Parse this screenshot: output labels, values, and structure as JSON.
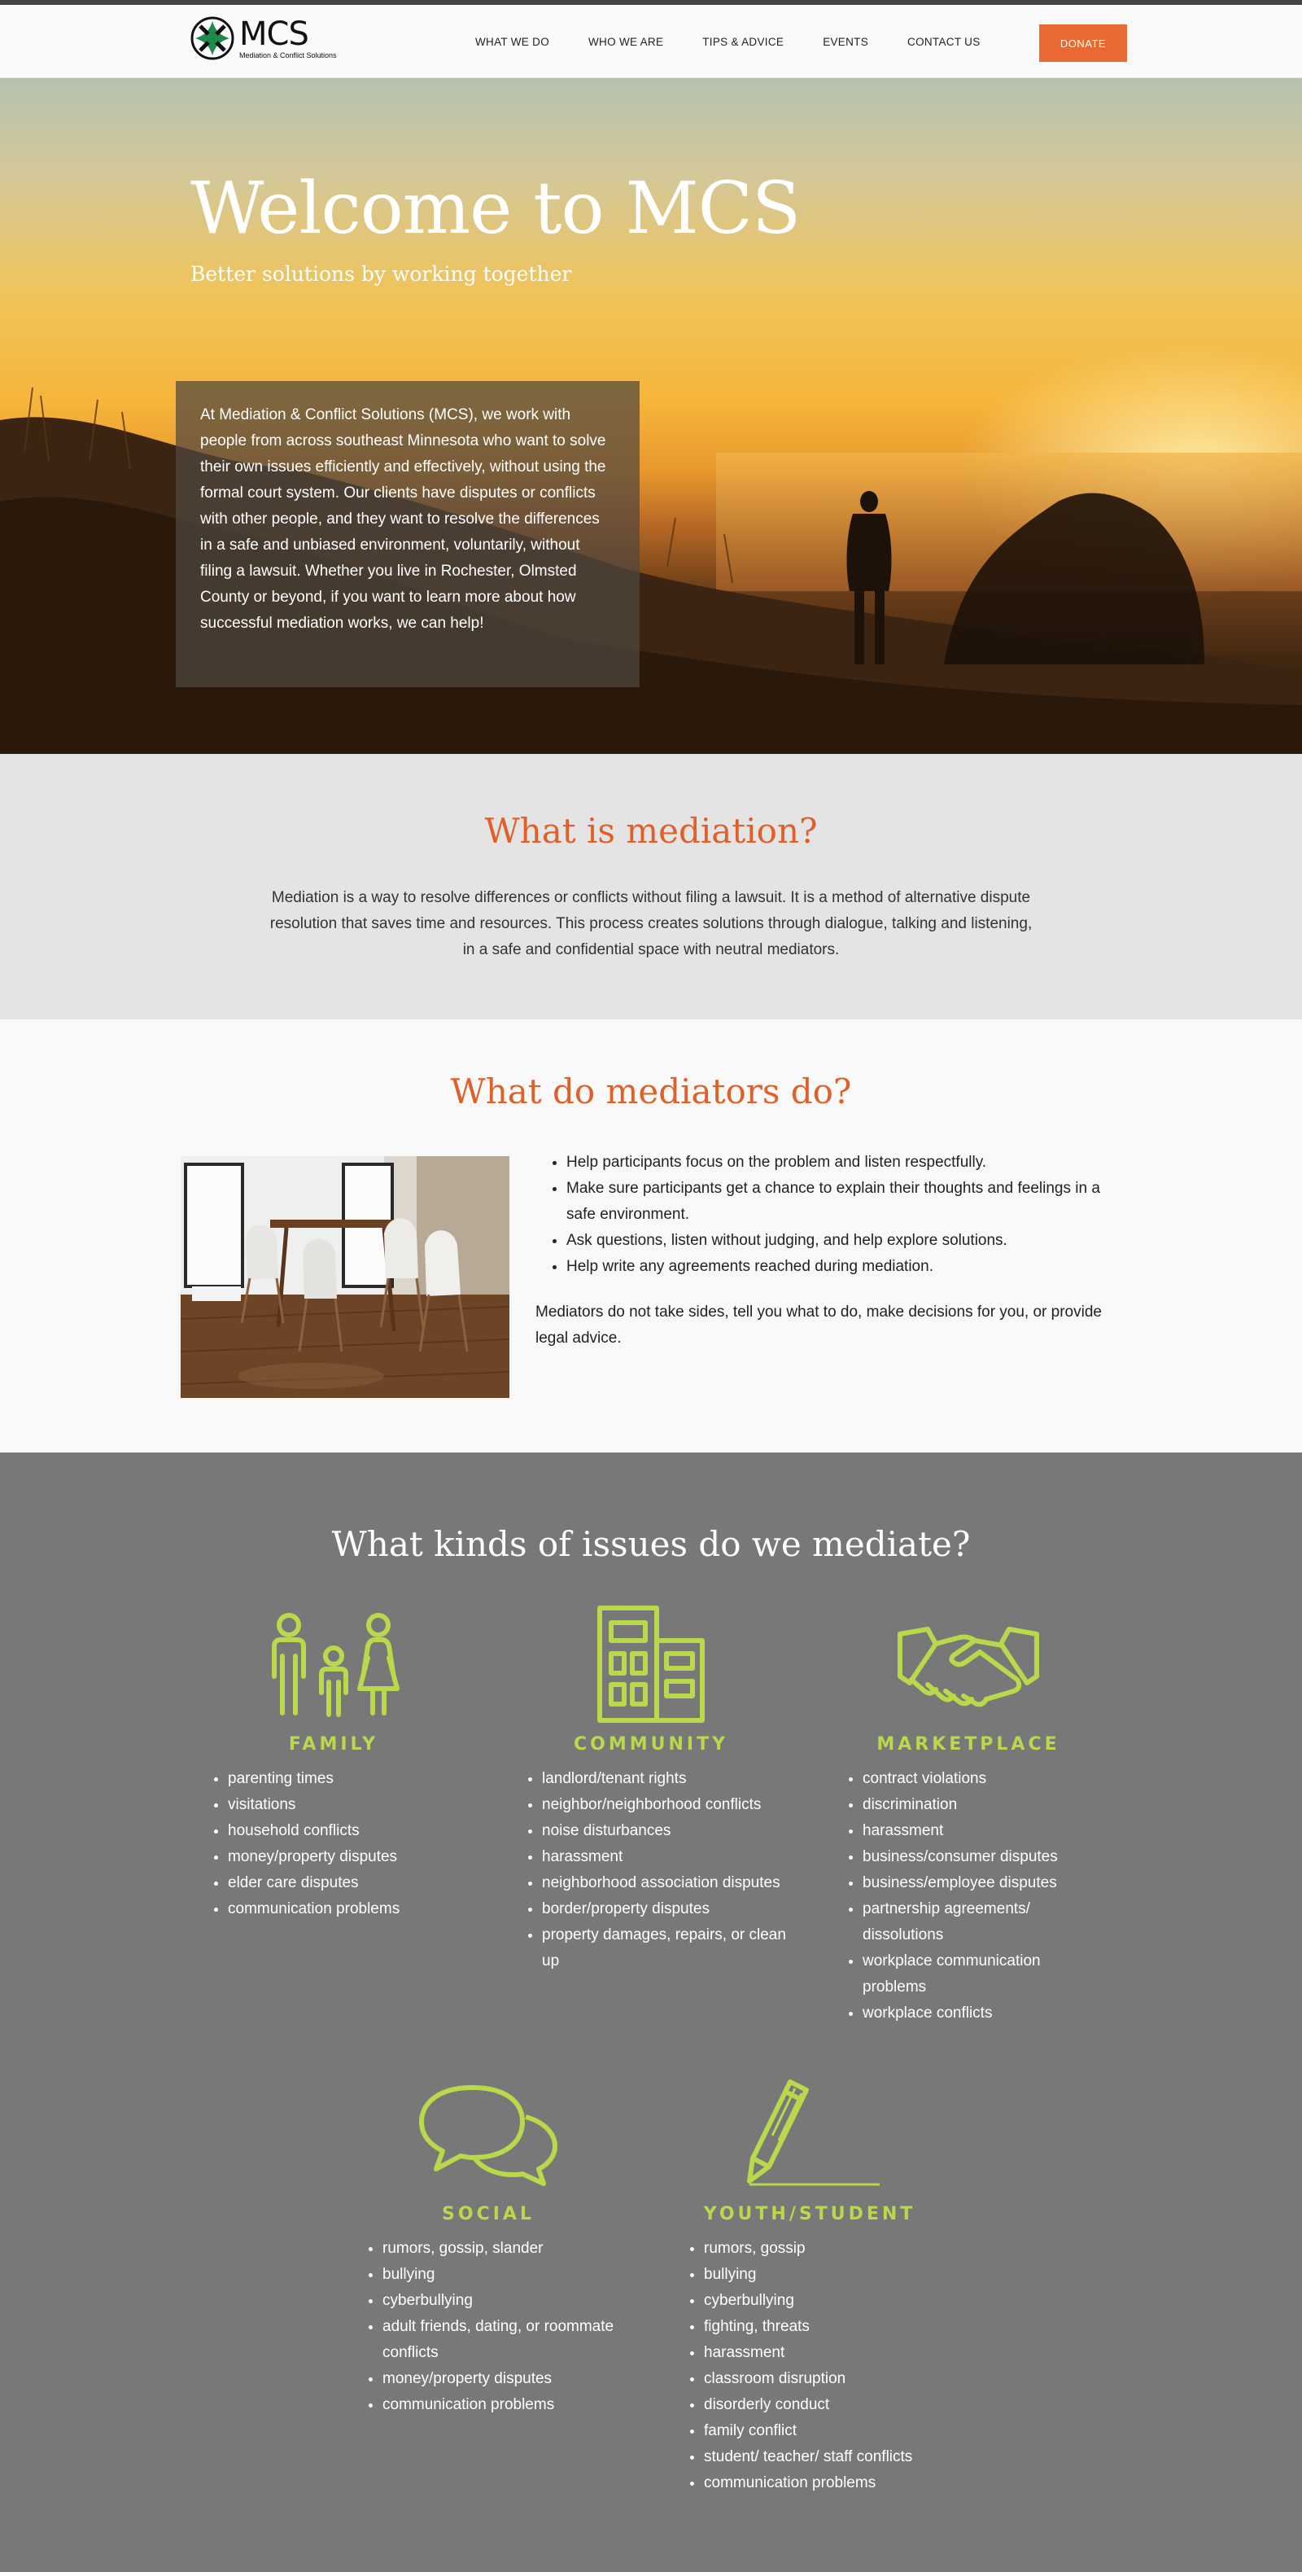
{
  "brand": {
    "name": "MCS",
    "tagline": "Mediation & Conflict Solutions"
  },
  "nav": {
    "items": [
      {
        "label": "WHAT WE DO"
      },
      {
        "label": "WHO WE ARE"
      },
      {
        "label": "TIPS & ADVICE"
      },
      {
        "label": "EVENTS"
      },
      {
        "label": "CONTACT US"
      }
    ],
    "donate_label": "DONATE"
  },
  "colors": {
    "accent": "#e86a33",
    "icon_green": "#b9d84b",
    "issues_bg": "#777877"
  },
  "hero": {
    "title": "Welcome to MCS",
    "subtitle": "Better solutions by working together",
    "body": "At Mediation & Conflict Solutions (MCS), we work with people from across southeast Minnesota who want to solve their own issues efficiently and effectively, without using the formal court system.  Our clients have disputes or conflicts with other people, and they want to resolve the differences in a safe and unbiased environment, voluntarily, without filing a lawsuit.  Whether you live in Rochester, Olmsted County or beyond, if you want to learn more about how successful mediation works, we can help!"
  },
  "mediation": {
    "title": "What is mediation?",
    "body": "Mediation is a way to resolve differences or conflicts without filing a lawsuit. It is a method of alternative dispute resolution that saves time and resources. This process creates solutions through dialogue, talking and listening, in a safe and confidential space with neutral mediators."
  },
  "mediators": {
    "title": "What do mediators do?",
    "bullets": [
      "Help participants focus on the problem and listen respectfully.",
      "Make sure participants get a chance to explain their thoughts and feelings in a safe environment.",
      "Ask questions, listen without judging, and help explore solutions.",
      "Help write any agreements reached during mediation."
    ],
    "note": "Mediators do not take sides, tell you what to do, make decisions for you, or provide legal advice."
  },
  "issues": {
    "title": "What kinds of issues do we mediate?",
    "categories": [
      {
        "heading": "FAMILY",
        "icon": "family-icon",
        "items": [
          "parenting times",
          "visitations",
          "household conflicts",
          "money/property disputes",
          "elder care disputes",
          "communication problems"
        ]
      },
      {
        "heading": "COMMUNITY",
        "icon": "buildings-icon",
        "items": [
          "landlord/tenant rights",
          "neighbor/neighborhood conflicts",
          "noise disturbances",
          "harassment",
          "neighborhood association disputes",
          "border/property disputes",
          "property damages, repairs, or clean up"
        ]
      },
      {
        "heading": "MARKETPLACE",
        "icon": "handshake-icon",
        "items": [
          "contract violations",
          "discrimination",
          "harassment",
          "business/consumer disputes",
          "business/employee disputes",
          "partnership agreements/ dissolutions",
          "workplace communication problems",
          "workplace conflicts"
        ]
      },
      {
        "heading": "SOCIAL",
        "icon": "speech-bubbles-icon",
        "items": [
          "rumors, gossip, slander",
          "bullying",
          "cyberbullying",
          "adult friends, dating, or roommate conflicts",
          "money/property disputes",
          "communication problems"
        ]
      },
      {
        "heading": "YOUTH/STUDENT",
        "icon": "pencil-icon",
        "items": [
          "rumors, gossip",
          "bullying",
          "cyberbullying",
          "fighting, threats",
          "harassment",
          "classroom disruption",
          "disorderly conduct",
          "family conflict",
          "student/ teacher/ staff conflicts",
          "communication problems"
        ]
      }
    ]
  }
}
